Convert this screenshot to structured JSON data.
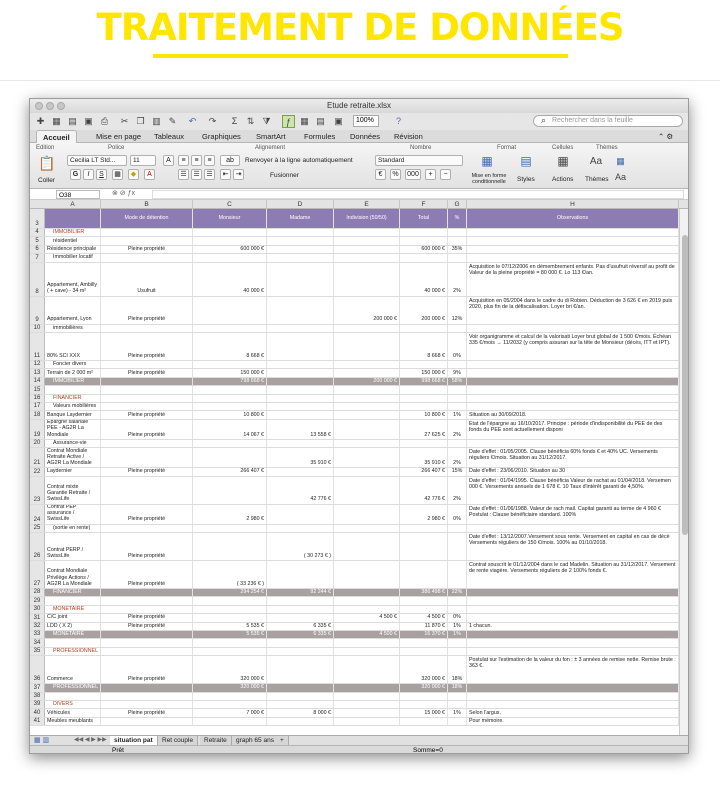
{
  "banner": {
    "title": "TRAITEMENT DE DONNÉES"
  },
  "window": {
    "title": "Etude retraite.xlsx"
  },
  "toolbar": {
    "zoom": "100%",
    "search_placeholder": "Rechercher dans la feuille"
  },
  "ribbon_tabs": [
    "Accueil",
    "Mise en page",
    "Tableaux",
    "Graphiques",
    "SmartArt",
    "Formules",
    "Données",
    "Révision"
  ],
  "ribbon": {
    "groups": {
      "edition": "Edition",
      "police": "Police",
      "alignement": "Alignement",
      "nombre": "Nombre",
      "format": "Format",
      "cellules": "Cellules",
      "themes": "Thèmes"
    },
    "coller": "Coller",
    "font_name": "Cecilia LT Std...",
    "font_size": "11",
    "wrap": "Renvoyer à la ligne automatiquement",
    "merge": "Fusionner",
    "number_format": "Standard",
    "cond_format": "Mise en forme conditionnelle",
    "styles": "Styles",
    "actions": "Actions",
    "themes": "Thèmes"
  },
  "formula_bar": {
    "cell_ref": "O38",
    "content": ""
  },
  "columns": [
    "A",
    "B",
    "C",
    "D",
    "E",
    "F",
    "G",
    "H"
  ],
  "header_row": {
    "num": "3",
    "cols": [
      "",
      "Mode de détention",
      "Monsieur",
      "Madame",
      "Indivision (50/50)",
      "Total",
      "%",
      "Observations"
    ]
  },
  "rows": [
    {
      "n": "4",
      "t": "sect",
      "cells": [
        "IMMOBILIER",
        "",
        "",
        "",
        "",
        "",
        "",
        ""
      ]
    },
    {
      "n": "5",
      "t": "sub",
      "cells": [
        "Immobilier résidentiel",
        "",
        "",
        "",
        "",
        "",
        "",
        ""
      ]
    },
    {
      "n": "6",
      "cells": [
        "Résidence principale",
        "Pleine propriété",
        "600 000 €",
        "",
        "",
        "600 000 €",
        "35%",
        ""
      ]
    },
    {
      "n": "7",
      "t": "sub",
      "cells": [
        "Immobilier locatif",
        "",
        "",
        "",
        "",
        "",
        "",
        ""
      ]
    },
    {
      "n": "8",
      "h": 34,
      "cells": [
        "Appartement, Ambilly ( + cave) - 34 m²",
        "Usufruit",
        "40 000 €",
        "",
        "",
        "40 000 €",
        "2%",
        "Acquisition le 07/12/2006 en démembrement enfants. Pas d'usufruit réversif au profit de Valeur de la pleine propriété = 80 000 €. Lo 113 €/an."
      ]
    },
    {
      "n": "9",
      "h": 28,
      "cells": [
        "Appartement, Lyon",
        "Pleine propriété",
        "",
        "",
        "200 000 €",
        "200 000 €",
        "12%",
        "Acquisition en 05/2004 dans le cadre du di Robien. Déduction de 3 626 € en 2019 puis 2020, plus fin de la défiscalisation. Loyer bri €/an."
      ]
    },
    {
      "n": "10",
      "t": "sub",
      "cells": [
        "Sociétés immobilières",
        "",
        "",
        "",
        "",
        "",
        "",
        ""
      ]
    },
    {
      "n": "11",
      "h": 28,
      "cells": [
        "80% SCI XXX",
        "Pleine propriété",
        "8 668 €",
        "",
        "",
        "8 668 €",
        "0%",
        "Voir organigramme et calcul de la valorisati Loyer brut global de 1 500 €/mois. Échéan 335 €/mois → 11/2032 (y compris assuran sur la tête de Monsieur (décès, ITT et IPT)."
      ]
    },
    {
      "n": "12",
      "t": "sub",
      "cells": [
        "Foncier divers",
        "",
        "",
        "",
        "",
        "",
        "",
        ""
      ]
    },
    {
      "n": "13",
      "cells": [
        "Terrain de 2 000 m²",
        "Pleine propriété",
        "150 000 €",
        "",
        "",
        "150 000 €",
        "9%",
        ""
      ]
    },
    {
      "n": "14",
      "t": "tot",
      "cells": [
        "IMMOBILIER",
        "",
        "798 668 €",
        "",
        "200 000 €",
        "998 668 €",
        "58%",
        ""
      ]
    },
    {
      "n": "15",
      "cells": [
        "",
        "",
        "",
        "",
        "",
        "",
        "",
        ""
      ]
    },
    {
      "n": "16",
      "t": "sect",
      "cells": [
        "FINANCIER",
        "",
        "",
        "",
        "",
        "",
        "",
        ""
      ]
    },
    {
      "n": "17",
      "t": "sub",
      "cells": [
        "Valeurs mobilières",
        "",
        "",
        "",
        "",
        "",
        "",
        ""
      ]
    },
    {
      "n": "18",
      "cells": [
        "Compte-titres / Banque Laydernier",
        "Pleine propriété",
        "10 800 €",
        "",
        "",
        "10 800 €",
        "1%",
        "Situation au 30/09/2018."
      ]
    },
    {
      "n": "19",
      "h": 20,
      "cells": [
        "Epargne salariale PEE - AG2R La Mondiale",
        "Pleine propriété",
        "14 067 €",
        "13 558 €",
        "",
        "27 625 €",
        "2%",
        "Etat de l'épargne au 16/10/2017. Principe : période d'indisponibilité du PEE de des fonds du PEE sont actuellement disponi"
      ]
    },
    {
      "n": "20",
      "t": "sub",
      "cells": [
        "Capitalisation / Assurance-vie",
        "",
        "",
        "",
        "",
        "",
        "",
        ""
      ]
    },
    {
      "n": "21",
      "h": 20,
      "cells": [
        "Contrat Mondiale Retraite Active / AG2R La Mondiale",
        "",
        "",
        "35 910 €",
        "",
        "35 910 €",
        "2%",
        "Date d'effet : 01/05/2005. Clause bénéficia 60% fonds € et 40% UC. Versements réguliers €/mois. Situation au 31/12/2017."
      ]
    },
    {
      "n": "22",
      "cells": [
        "Contrat Arrtarius Avenir / Banque Laydernier",
        "Pleine propriété",
        "266 407 €",
        "",
        "",
        "266 407 €",
        "15%",
        "Date d'effet : 23/06/2010. Situation au 30"
      ]
    },
    {
      "n": "23",
      "h": 28,
      "cells": [
        "Contrat mixte Garantie Retraite / SwissLife",
        "",
        "",
        "42 776 €",
        "",
        "42 776 €",
        "2%",
        "Date d'effet : 01/04/1995. Clause bénéficia Valeur de rachat au 01/04/2018. Versemen 000 €. Versements annuels de 1 678 €. 10 Taux d'intérêt garanti de 4,50%."
      ]
    },
    {
      "n": "24",
      "h": 20,
      "cells": [
        "Contrat PEP assurance / SwissLife",
        "Pleine propriété",
        "2 980 €",
        "",
        "",
        "2 980 €",
        "0%",
        "Date d'effet : 01/06/1988. Valeur de rach mail. Capital garanti au terme de 4 960 € Postulat : Clause bénéficiaire standard. 100%"
      ]
    },
    {
      "n": "25",
      "t": "sub",
      "cells": [
        "Épargne retraite non rachetable (sortie en rente)",
        "",
        "",
        "",
        "",
        "",
        "",
        ""
      ]
    },
    {
      "n": "26",
      "h": 28,
      "cells": [
        "Contrat PERP / SwissLife",
        "Pleine propriété",
        "",
        "( 30 273 € )",
        "",
        "",
        "",
        "Date d'effet : 13/12/2007.Versement sous rente. Versement en capital en cas de décè Versements réguliers de 150 €/mois. 100% au 01/10/2018."
      ]
    },
    {
      "n": "27",
      "h": 28,
      "cells": [
        "Contrat Mondiale Privilège Actions / AG2R La Mondiale",
        "Pleine propriété",
        "( 33 236 € )",
        "",
        "",
        "",
        "",
        "Contrat souscrit le 01/12/2004 dans le cad Madelin. Situation au 31/12/2017. Versement de rente viagère. Versements réguliers de 2 100% fonds €."
      ]
    },
    {
      "n": "28",
      "t": "tot",
      "cells": [
        "FINANCIER",
        "",
        "294 254 €",
        "92 244 €",
        "",
        "386 498 €",
        "22%",
        ""
      ]
    },
    {
      "n": "29",
      "cells": [
        "",
        "",
        "",
        "",
        "",
        "",
        "",
        ""
      ]
    },
    {
      "n": "30",
      "t": "sect",
      "cells": [
        "MONETAIRE",
        "",
        "",
        "",
        "",
        "",
        "",
        ""
      ]
    },
    {
      "n": "31",
      "cells": [
        "C/C joint",
        "Pleine propriété",
        "",
        "",
        "4 500 €",
        "4 500 €",
        "0%",
        ""
      ]
    },
    {
      "n": "32",
      "cells": [
        "LDD ( X 2)",
        "Pleine propriété",
        "5 535 €",
        "6 335 €",
        "",
        "11 870 €",
        "1%",
        "1 chacun."
      ]
    },
    {
      "n": "33",
      "t": "tot",
      "cells": [
        "MONETAIRE",
        "",
        "5 535 €",
        "6 335 €",
        "4 500 €",
        "16 370 €",
        "1%",
        ""
      ]
    },
    {
      "n": "34",
      "cells": [
        "",
        "",
        "",
        "",
        "",
        "",
        "",
        ""
      ]
    },
    {
      "n": "35",
      "t": "sect",
      "cells": [
        "PROFESSIONNEL",
        "",
        "",
        "",
        "",
        "",
        "",
        ""
      ]
    },
    {
      "n": "36",
      "h": 28,
      "cells": [
        "Commerce",
        "Pleine propriété",
        "320 000 €",
        "",
        "",
        "320 000 €",
        "18%",
        "Postulat sur l'estimation de la valeur du fon : ± 3 années de remise nette. Remise brute : 363 €."
      ]
    },
    {
      "n": "37",
      "t": "tot",
      "cells": [
        "PROFESSIONNEL",
        "",
        "320 000 €",
        "",
        "",
        "320 000 €",
        "18%",
        ""
      ]
    },
    {
      "n": "38",
      "cells": [
        "",
        "",
        "",
        "",
        "",
        "",
        "",
        ""
      ]
    },
    {
      "n": "39",
      "t": "sect",
      "cells": [
        "DIVERS",
        "",
        "",
        "",
        "",
        "",
        "",
        ""
      ]
    },
    {
      "n": "40",
      "cells": [
        "Véhicules",
        "Pleine propriété",
        "7 000 €",
        "8 000 €",
        "",
        "15 000 €",
        "1%",
        "Selon l'argus."
      ]
    },
    {
      "n": "41",
      "cells": [
        "Meubles meublants",
        "",
        "",
        "",
        "",
        "",
        "",
        "Pour mémoire."
      ]
    }
  ],
  "sheet_tabs": [
    "situation pat",
    "Ret couple",
    "Retraite",
    "graph 65 ans"
  ],
  "status": {
    "ready": "Prêt",
    "sum": "Somme=0"
  }
}
